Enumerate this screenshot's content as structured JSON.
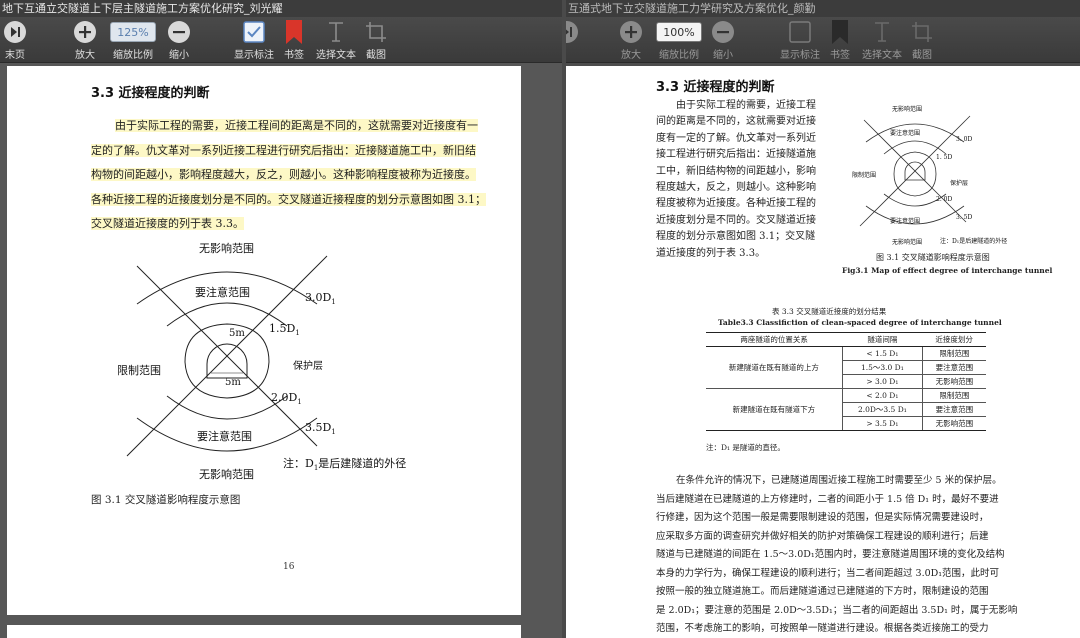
{
  "left": {
    "window_title": "地下互通立交隧道上下层主隧道施工方案优化研究_刘光耀",
    "toolbar": {
      "last_page": "末页",
      "zoom_in": "放大",
      "zoom_value": "125%",
      "zoom_ratio": "缩放比例",
      "zoom_out": "缩小",
      "show_annotations": "显示标注",
      "bookmark": "书签",
      "select_text": "选择文本",
      "screenshot": "截图"
    },
    "doc": {
      "heading": "3.3 近接程度的判断",
      "para_lines": [
        "由于实际工程的需要，近接工程间的距离是不同的，这就需要对近接度有一",
        "定的了解。仇文革对一系列近接工程进行研究后指出：近接隧道施工中，新旧结",
        "构物的间距越小，影响程度越大，反之，则越小。这种影响程度被称为近接度。",
        "各种近接工程的近接度划分是不同的。交叉隧道近接程度的划分示意图如图 3.1；",
        "交叉隧道近接度的列于表 3.3。"
      ],
      "diagram": {
        "no_effect_top": "无影响范围",
        "attention_top": "要注意范围",
        "d30": "3.0D",
        "d15": "1.5D",
        "m5_top": "5m",
        "restrict": "限制范围",
        "protect": "保护层",
        "m5_bottom": "5m",
        "d20": "2.0D",
        "d35": "3.5D",
        "attention_bottom": "要注意范围",
        "no_effect_bottom": "无影响范围",
        "note": "注：D",
        "note_tail": "是后建隧道的外径",
        "sub1": "1",
        "sub2": "1",
        "sub3": "1",
        "sub4": "1",
        "sub5": "1"
      },
      "caption": "图 3.1 交叉隧道影响程度示意图",
      "page_number": "16"
    }
  },
  "right": {
    "window_title": "互通式地下立交隧道施工力学研究及方案优化_颜勤",
    "toolbar": {
      "zoom_in": "放大",
      "zoom_value": "100%",
      "zoom_ratio": "缩放比例",
      "zoom_out": "缩小",
      "show_annotations": "显示标注",
      "bookmark": "书签",
      "select_text": "选择文本",
      "screenshot": "截图"
    },
    "doc": {
      "heading": "3.3  近接程度的判断",
      "para_lines": [
        "由于实际工程的需要，近接工程",
        "间的距离是不同的，这就需要对近接",
        "度有一定的了解。仇文革对一系列近",
        "接工程进行研究后指出：近接隧道施",
        "工中，新旧结构物的间距越小，影响",
        "程度越大，反之，则越小。这种影响",
        "程度被称为近接度。各种近接工程的",
        "近接度划分是不同的。交叉隧道近接",
        "程度的划分示意图如图 3.1；交叉隧",
        "道近接度的列于表 3.3。"
      ],
      "fig_caption_cn": "图 3.1  交叉隧道影响程度示意图",
      "fig_caption_en": "Fig3.1 Map of effect degree of interchange tunnel",
      "fig_labels": {
        "no_effect_top": "无影响范围",
        "attention_top": "要注意范围",
        "d30": "3. 0D",
        "d15": "1. 5D",
        "restrict": "限制范围",
        "protect": "保护层",
        "d20": "2. 0D",
        "d35": "3. 5D",
        "attention_bottom": "要注意范围",
        "no_effect_bottom": "无影响范围",
        "note": "注：D₁是后建隧道的外径"
      },
      "table": {
        "title_cn": "表 3.3  交叉隧道近接度的划分结果",
        "title_en": "Table3.3 Classifiction of clean-spaced degree of interchange tunnel",
        "headers": [
          "两座隧道的位置关系",
          "隧道间隔",
          "近接度划分"
        ],
        "group1": "新建隧道在既有隧道的上方",
        "group2": "新建隧道在既有隧道下方",
        "rows1": [
          [
            "< 1.5 D₁",
            "限制范围"
          ],
          [
            "1.5～3.0 D₁",
            "要注意范围"
          ],
          [
            "> 3.0 D₁",
            "无影响范围"
          ]
        ],
        "rows2": [
          [
            "< 2.0 D₁",
            "限制范围"
          ],
          [
            "2.0D～3.5 D₁",
            "要注意范围"
          ],
          [
            "> 3.5 D₁",
            "无影响范围"
          ]
        ],
        "note": "注：D₁ 是隧道的直径。"
      },
      "para2_lines": [
        "在条件允许的情况下，已建隧道周围近接工程施工时需要至少 5 米的保护层。",
        "当后建隧道在已建隧道的上方修建时，二者的间距小于 1.5 倍 D₁ 时，最好不要进",
        "行修建，因为这个范围一般是需要限制建设的范围，但是实际情况需要建设时，",
        "应采取多方面的调查研究并做好相关的防护对策确保工程建设的顺利进行；后建",
        "隧道与已建隧道的间距在 1.5～3.0D₁范围内时，要注意隧道周围环境的变化及结构",
        "本身的力学行为，确保工程建设的顺利进行；当二者间距超过 3.0D₁范围，此时可",
        "按照一般的独立隧道施工。而后建隧道通过已建隧道的下方时，限制建设的范围",
        "是 2.0D₁；要注意的范围是 2.0D～3.5D₁；当二者的间距超出 3.5D₁ 时，属于无影响",
        "范围，不考虑施工的影响，可按照单一隧道进行建设。根据各类近接施工的受力"
      ]
    }
  }
}
